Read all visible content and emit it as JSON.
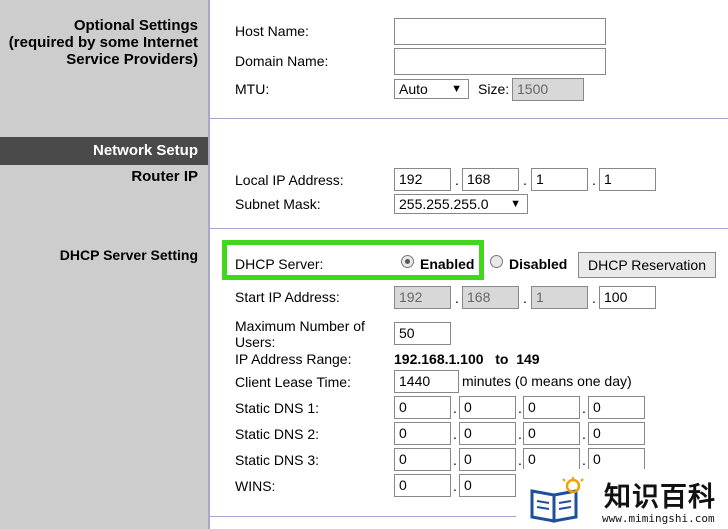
{
  "sidebar": {
    "optional_settings": [
      "Optional Settings",
      "(required by some Internet",
      "Service Providers)"
    ],
    "network_setup": "Network Setup",
    "router_ip": "Router IP",
    "dhcp_server_setting": "DHCP Server Setting"
  },
  "optional": {
    "host_name_label": "Host Name:",
    "host_name_value": "",
    "domain_name_label": "Domain Name:",
    "domain_name_value": "",
    "mtu_label": "MTU:",
    "mtu_value": "Auto",
    "size_label": "Size:",
    "size_value": "1500"
  },
  "router_ip": {
    "local_ip_label": "Local IP Address:",
    "local_ip": [
      "192",
      "168",
      "1",
      "1"
    ],
    "subnet_label": "Subnet Mask:",
    "subnet_value": "255.255.255.0"
  },
  "dhcp": {
    "server_label": "DHCP Server:",
    "enabled_label": "Enabled",
    "disabled_label": "Disabled",
    "selected": "Enabled",
    "reservation_button": "DHCP Reservation",
    "start_ip_label": "Start IP Address:",
    "start_ip": [
      "192",
      "168",
      "1",
      "100"
    ],
    "max_users_label_1": "Maximum Number of",
    "max_users_label_2": "Users:",
    "max_users_value": "50",
    "ip_range_label": "IP Address Range:",
    "ip_range_value": "192.168.1.100   to  149",
    "lease_label": "Client Lease Time:",
    "lease_value": "1440",
    "lease_unit": "minutes (0 means one day)",
    "dns1_label": "Static DNS 1:",
    "dns1": [
      "0",
      "0",
      "0",
      "0"
    ],
    "dns2_label": "Static DNS 2:",
    "dns2": [
      "0",
      "0",
      "0",
      "0"
    ],
    "dns3_label": "Static DNS 3:",
    "dns3": [
      "0",
      "0",
      "0",
      "0"
    ],
    "wins_label": "WINS:",
    "wins": [
      "0",
      "0"
    ]
  },
  "watermark": {
    "title": "知识百科",
    "url": "www.mimingshi.com"
  },
  "colors": {
    "sidebar_bg": "#cdcdcd",
    "network_bar": "#4a4a4a",
    "highlight_green": "#3fd81d",
    "separator": "#a7a7c8"
  }
}
